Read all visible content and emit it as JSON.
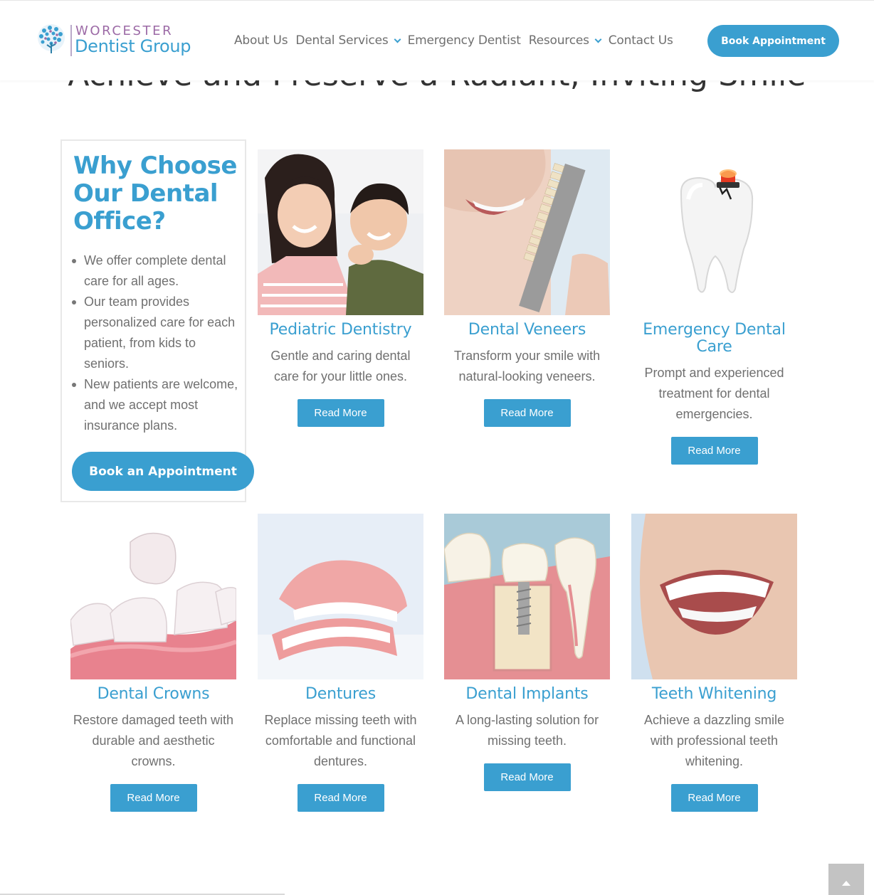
{
  "brand": {
    "logo_top": "WORCESTER",
    "logo_bottom": "Dentist Group",
    "logo_top_color": "#9c6aa6",
    "logo_bottom_color": "#3a9fd0"
  },
  "nav": {
    "items": [
      {
        "label": "About Us",
        "has_dropdown": false
      },
      {
        "label": "Dental Services",
        "has_dropdown": true
      },
      {
        "label": "Emergency Dentist",
        "has_dropdown": false
      },
      {
        "label": "Resources",
        "has_dropdown": true
      },
      {
        "label": "Contact Us",
        "has_dropdown": false
      }
    ],
    "cta_label": "Book Appointment"
  },
  "hero": {
    "title": "Achieve and Preserve a Radiant, Inviting Smile"
  },
  "why": {
    "title": "Why Choose Our Dental Office?",
    "points": [
      "We offer complete dental care for all ages.",
      "Our team provides personalized care for each patient, from kids to seniors.",
      "New patients are welcome, and we accept most insurance plans."
    ],
    "cta_label": "Book an Appointment"
  },
  "services": [
    {
      "title": "Pediatric Dentistry",
      "description": "Gentle and caring dental care for your little ones.",
      "button": "Read More",
      "image": "children-smiling-photo"
    },
    {
      "title": "Dental Veneers",
      "description": "Transform your smile with natural-looking veneers.",
      "button": "Read More",
      "image": "veneer-shade-guide-photo"
    },
    {
      "title": "Emergency Dental Care",
      "description": "Prompt and experienced treatment for dental emergencies.",
      "button": "Read More",
      "image": "tooth-with-alarm-light"
    },
    {
      "title": "Dental Crowns",
      "description": "Restore damaged teeth with durable and aesthetic crowns.",
      "button": "Read More",
      "image": "crown-over-tooth-render"
    },
    {
      "title": "Dentures",
      "description": "Replace missing teeth with comfortable and functional dentures.",
      "button": "Read More",
      "image": "denture-photo"
    },
    {
      "title": "Dental Implants",
      "description": "A long-lasting solution for missing teeth.",
      "button": "Read More",
      "image": "implant-cross-section-render"
    },
    {
      "title": "Teeth Whitening",
      "description": "Achieve a dazzling smile with professional teeth whitening.",
      "button": "Read More",
      "image": "white-smile-photo"
    }
  ],
  "colors": {
    "accent": "#3a9fd0",
    "text": "#707070",
    "heading": "#333333"
  },
  "scroll_to_top_icon": "chevron-up-icon"
}
